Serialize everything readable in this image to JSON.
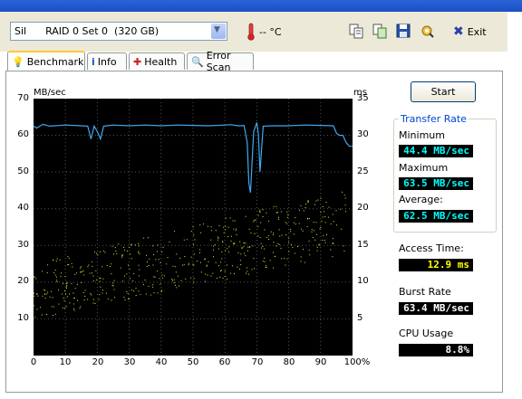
{
  "toolbar": {
    "drive": "Sil      RAID 0 Set 0  (320 GB)",
    "temperature": "-- °C",
    "exit_label": "Exit"
  },
  "tabs": [
    {
      "label": "Benchmark",
      "icon": "benchmark-icon"
    },
    {
      "label": "Info",
      "icon": "info-icon"
    },
    {
      "label": "Health",
      "icon": "health-icon"
    },
    {
      "label": "Error Scan",
      "icon": "error-scan-icon"
    }
  ],
  "start_label": "Start",
  "transfer_rate": {
    "title": "Transfer Rate",
    "minimum_label": "Minimum",
    "minimum": "44.4 MB/sec",
    "maximum_label": "Maximum",
    "maximum": "63.5 MB/sec",
    "average_label": "Average:",
    "average": "62.5 MB/sec"
  },
  "access_time": {
    "label": "Access Time:",
    "value": "12.9 ms"
  },
  "burst_rate": {
    "label": "Burst Rate",
    "value": "63.4 MB/sec"
  },
  "cpu_usage": {
    "label": "CPU Usage",
    "value": "8.8%"
  },
  "colors": {
    "transfer_line": "#3fa9f5",
    "access_points": "#e8e830",
    "cyan_value": "#00ffff",
    "yellow_value": "#ffff00",
    "white_value": "#ffffff"
  },
  "chart_data": {
    "type": "line",
    "ylabel": "MB/sec",
    "y2label": "ms",
    "ylim": [
      0,
      70
    ],
    "y2lim": [
      0,
      35
    ],
    "yticks": [
      "70",
      "60",
      "50",
      "40",
      "30",
      "20",
      "10"
    ],
    "y2ticks": [
      "35",
      "30",
      "25",
      "20",
      "15",
      "10",
      "5"
    ],
    "xticks": [
      "0",
      "10",
      "20",
      "30",
      "40",
      "50",
      "60",
      "70",
      "80",
      "90",
      "100%"
    ],
    "grid": true,
    "series": [
      {
        "x": [
          0,
          1,
          2,
          3,
          5,
          10,
          15,
          17,
          18,
          19,
          20,
          21,
          22,
          23,
          25,
          30,
          35,
          40,
          45,
          50,
          55,
          60,
          62,
          64,
          65,
          66,
          67,
          67.5,
          68,
          69,
          70,
          70.5,
          71,
          72,
          75,
          80,
          85,
          90,
          94,
          95,
          96,
          97,
          98,
          99,
          100
        ],
        "values": [
          62.5,
          62,
          62.5,
          63,
          62.5,
          62.8,
          62.6,
          62.5,
          59,
          62.5,
          61,
          59,
          62.5,
          62.6,
          62.8,
          62.6,
          62.8,
          62.6,
          62.8,
          62.7,
          62.6,
          62.8,
          62.9,
          62.6,
          62.6,
          62.7,
          58,
          47,
          44.4,
          61,
          63.5,
          60,
          50,
          62.5,
          62.6,
          62.6,
          62.8,
          62.7,
          62.6,
          60.5,
          60,
          60,
          58,
          57,
          57
        ]
      }
    ],
    "access_time_scatter": {
      "y_unit": "ms",
      "approx_range_at_0pct": [
        5,
        12.5
      ],
      "approx_range_at_100pct": [
        14,
        23
      ]
    }
  }
}
